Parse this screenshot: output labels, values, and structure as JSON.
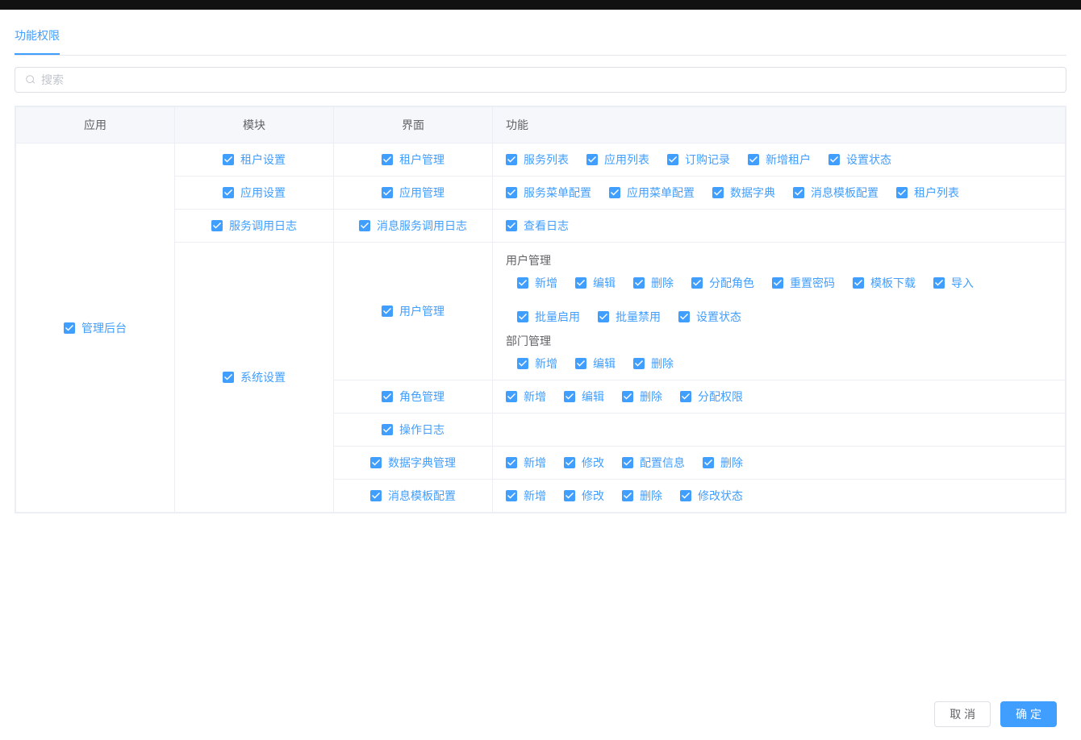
{
  "tabs": {
    "active_label": "功能权限"
  },
  "search": {
    "placeholder": "搜索"
  },
  "headers": {
    "app": "应用",
    "module": "模块",
    "interface": "界面",
    "function": "功能"
  },
  "app": {
    "label": "管理后台"
  },
  "modules": {
    "m0": "租户设置",
    "m1": "应用设置",
    "m2": "服务调用日志",
    "m3": "系统设置"
  },
  "interfaces": {
    "i0": "租户管理",
    "i1": "应用管理",
    "i2": "消息服务调用日志",
    "i3": "用户管理",
    "i4": "角色管理",
    "i5": "操作日志",
    "i6": "数据字典管理",
    "i7": "消息模板配置"
  },
  "funcs": {
    "r0": [
      "服务列表",
      "应用列表",
      "订购记录",
      "新增租户",
      "设置状态"
    ],
    "r1": [
      "服务菜单配置",
      "应用菜单配置",
      "数据字典",
      "消息模板配置",
      "租户列表"
    ],
    "r2": [
      "查看日志"
    ],
    "g3a_title": "用户管理",
    "g3a": [
      "新增",
      "编辑",
      "删除",
      "分配角色",
      "重置密码",
      "模板下载",
      "导入",
      "批量启用",
      "批量禁用",
      "设置状态"
    ],
    "g3b_title": "部门管理",
    "g3b": [
      "新增",
      "编辑",
      "删除"
    ],
    "r4": [
      "新增",
      "编辑",
      "删除",
      "分配权限"
    ],
    "r6": [
      "新增",
      "修改",
      "配置信息",
      "删除"
    ],
    "r7": [
      "新增",
      "修改",
      "删除",
      "修改状态"
    ]
  },
  "footer": {
    "cancel": "取 消",
    "confirm": "确 定"
  }
}
